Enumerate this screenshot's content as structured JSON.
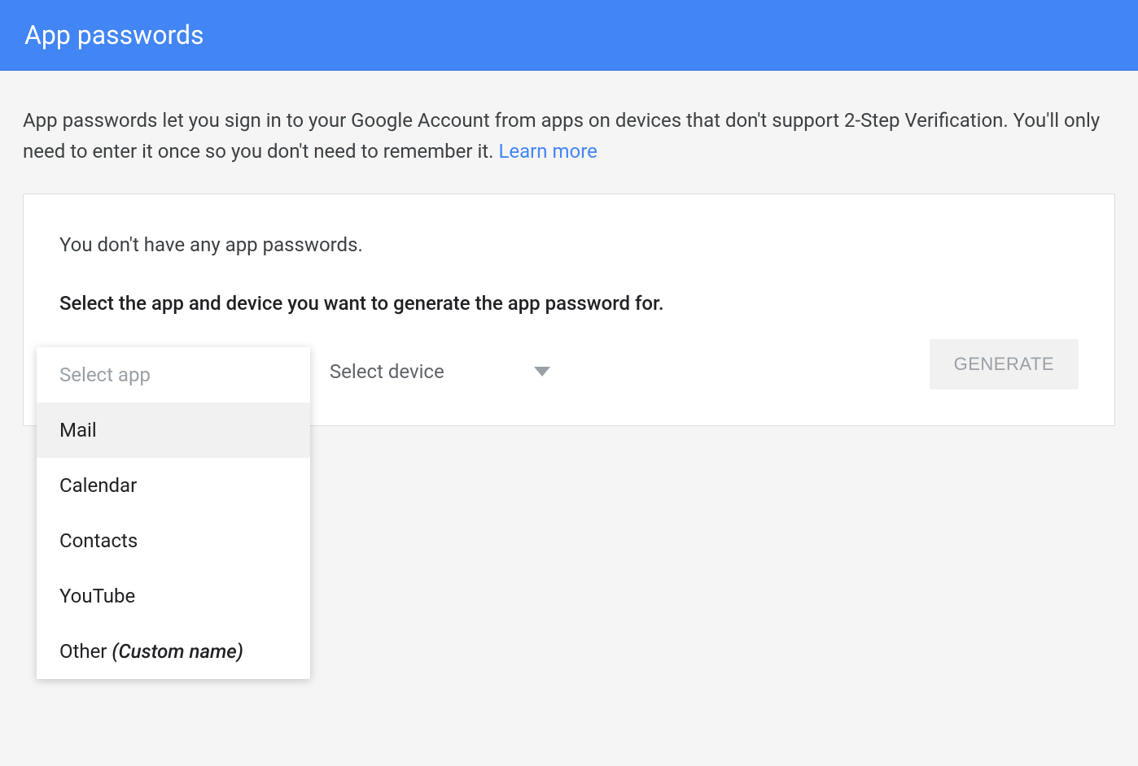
{
  "header": {
    "title": "App passwords"
  },
  "description": {
    "text": "App passwords let you sign in to your Google Account from apps on devices that don't support 2-Step Verification. You'll only need to enter it once so you don't need to remember it. ",
    "learn_more": "Learn more"
  },
  "card": {
    "no_passwords": "You don't have any app passwords.",
    "instruction": "Select the app and device you want to generate the app password for.",
    "select_app_label": "Select app",
    "select_device_label": "Select device",
    "generate_label": "GENERATE",
    "app_dropdown": {
      "header": "Select app",
      "options": [
        {
          "label": "Mail",
          "hovered": true
        },
        {
          "label": "Calendar",
          "hovered": false
        },
        {
          "label": "Contacts",
          "hovered": false
        },
        {
          "label": "YouTube",
          "hovered": false
        }
      ],
      "other_label": "Other",
      "other_custom": "(Custom name)"
    }
  }
}
